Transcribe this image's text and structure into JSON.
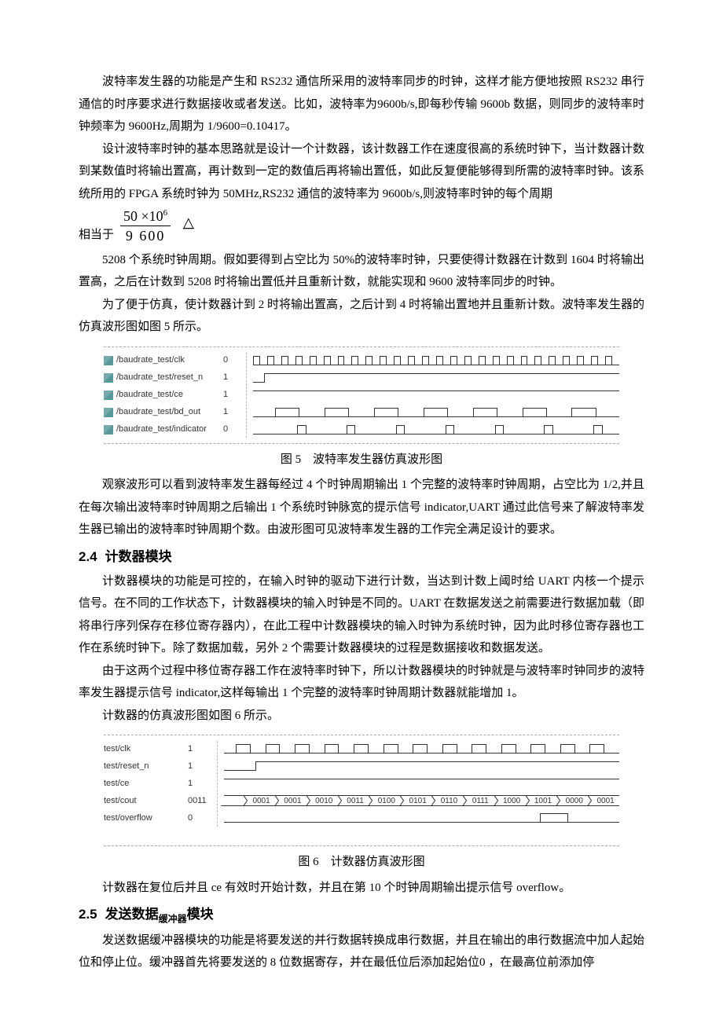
{
  "p1": "波特率发生器的功能是产生和 RS232 通信所采用的波特率同步的时钟，这样才能方便地按照 RS232 串行通信的时序要求进行数据接收或者发送。比如，波特率为9600b/s,即每秒传输 9600b 数据，则同步的波特率时钟频率为 9600Hz,周期为 1/9600=0.10417。",
  "p2": "设计波特率时钟的基本思路就是设计一个计数器，该计数器工作在速度很高的系统时钟下，当计数器计数到某数值时将输出置高，再计数到一定的数值后再将输出置低，如此反复便能够得到所需的波特率时钟。该系统所用的 FPGA 系统时钟为 50MHz,RS232 通信的波特率为 9600b/s,则波特率时钟的每个周期",
  "formula_prefix": "相当于",
  "formula_num": "50 ×10",
  "formula_num_sup": "6",
  "formula_den": "9 600",
  "formula_delta": "△",
  "p3": "5208 个系统时钟周期。假如要得到占空比为 50%的波特率时钟，只要使得计数器在计数到 1604 时将输出置高，之后在计数到 5208 时将输出置低并且重新计数，就能实现和 9600 波特率同步的时钟。",
  "p4": "为了便于仿真，使计数器计到 2 时将输出置高，之后计到 4 时将输出置地并且重新计数。波特率发生器的仿真波形图如图 5 所示。",
  "fig5_rows": [
    {
      "label": "/baudrate_test/clk",
      "init": "0",
      "type": "clk"
    },
    {
      "label": "/baudrate_test/reset_n",
      "init": "1",
      "type": "reset"
    },
    {
      "label": "/baudrate_test/ce",
      "init": "1",
      "type": "high"
    },
    {
      "label": "/baudrate_test/bd_out",
      "init": "1",
      "type": "bdout"
    },
    {
      "label": "/baudrate_test/indicator",
      "init": "0",
      "type": "indic"
    }
  ],
  "fig5_caption": "图 5　波特率发生器仿真波形图",
  "p5": "观察波形可以看到波特率发生器每经过 4 个时钟周期输出 1 个完整的波特率时钟周期，占空比为 1/2,并且在每次输出波特率时钟周期之后输出 1 个系统时钟脉宽的提示信号 indicator,UART 通过此信号来了解波特率发生器已输出的波特率时钟周期个数。由波形图可见波特率发生器的工作完全满足设计的要求。",
  "h24_num": "2.4",
  "h24_title": "计数器模块",
  "p6": "计数器模块的功能是可控的，在输入时钟的驱动下进行计数，当达到计数上阈时给 UART 内核一个提示信号。在不同的工作状态下，计数器模块的输入时钟是不同的。UART 在数据发送之前需要进行数据加载（即将串行序列保存在移位寄存器内），在此工程中计数器模块的输入时钟为系统时钟，因为此时移位寄存器也工作在系统时钟下。除了数据加载，另外 2 个需要计数器模块的过程是数据接收和数据发送。",
  "p7": "由于这两个过程中移位寄存器工作在波特率时钟下，所以计数器模块的时钟就是与波特率时钟同步的波特率发生器提示信号 indicator,这样每输出 1 个完整的波特率时钟周期计数器就能增加 1。",
  "p8": "计数器的仿真波形图如图 6 所示。",
  "fig6_rows": [
    {
      "label": "test/clk",
      "init": "1",
      "type": "clk6"
    },
    {
      "label": "test/reset_n",
      "init": "1",
      "type": "reset6"
    },
    {
      "label": "test/ce",
      "init": "1",
      "type": "high"
    },
    {
      "label": "test/cout",
      "init": "0011",
      "type": "bus"
    },
    {
      "label": "test/overflow",
      "init": "0",
      "type": "ovf"
    }
  ],
  "fig6_bus": [
    "0001",
    "0001",
    "0010",
    "0011",
    "0100",
    "0101",
    "0110",
    "0111",
    "1000",
    "1001",
    "0000",
    "0001"
  ],
  "fig6_caption": "图 6　计数器仿真波形图",
  "p9": "计数器在复位后并且 ce 有效时开始计数，并且在第 10 个时钟周期输出提示信号 overflow。",
  "h25_num": "2.5",
  "h25_pre": "发送数据",
  "h25_sub": "缓冲器",
  "h25_post": "模块",
  "p10": "发送数据缓冲器模块的功能是将要发送的并行数据转换成串行数据，并且在输出的串行数据流中加人起始位和停止位。缓冲器首先将要发送的 8 位数据寄存，并在最低位后添加起始位0 ，在最高位前添加停"
}
